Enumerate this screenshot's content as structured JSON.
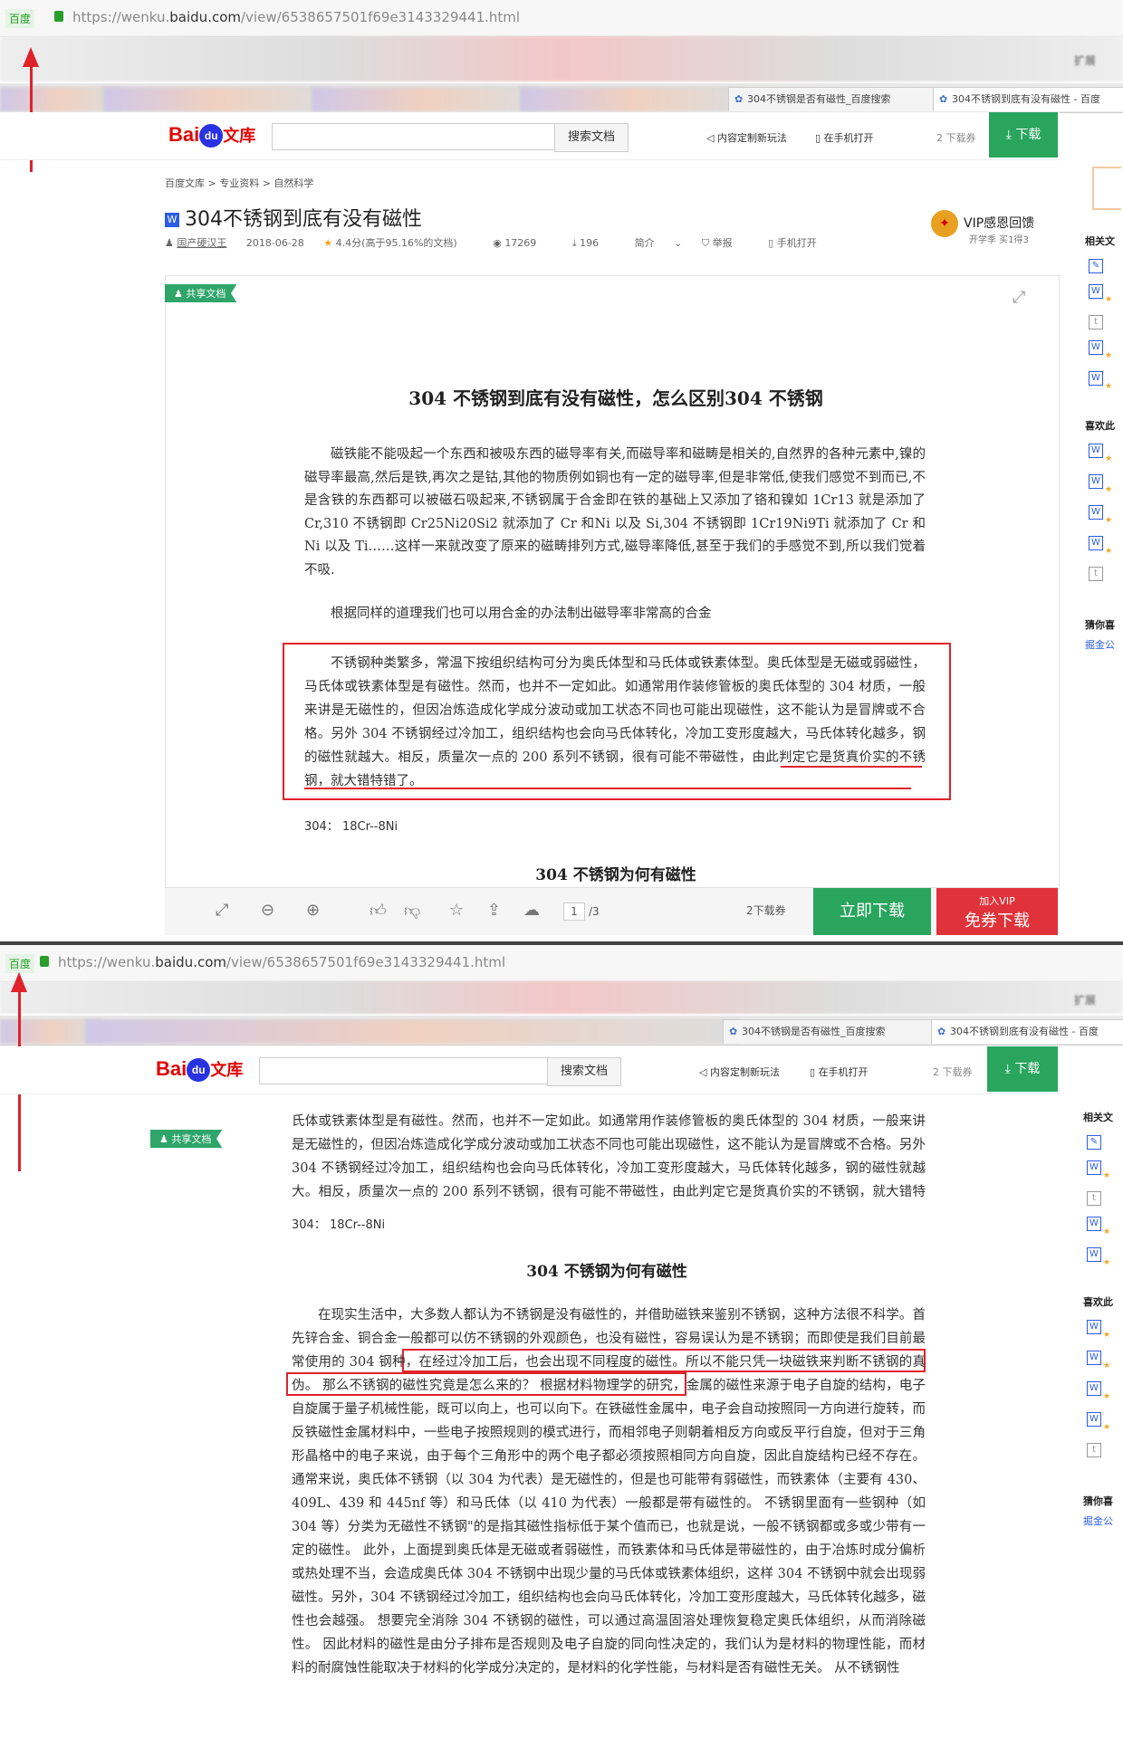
{
  "browser": {
    "site_tag": "百度",
    "url_prefix": "https://wenku.",
    "url_domain": "baidu.com",
    "url_path": "/view/6538657501f69e3143329441.html",
    "ext_label": "扩展",
    "tab_search_title": "304不锈钢是否有磁性_百度搜索",
    "tab_doc_title": "304不锈钢到底有没有磁性 - 百度"
  },
  "header": {
    "logo_bai": "Bai",
    "logo_du": "du",
    "logo_wenku": "文库",
    "search_button": "搜索文档",
    "link_custom": "内容定制新玩法",
    "link_phone": "在手机打开",
    "coupons": "2 下载券",
    "download": "下载"
  },
  "doc": {
    "breadcrumb": "百度文库 > 专业资料 > 自然科学",
    "title": "304不锈钢到底有没有磁性",
    "author": "国产硬汉王",
    "date": "2018-06-28",
    "rating": "4.4分(高于95.16%的文档)",
    "views": "17269",
    "downloads": "196",
    "intro": "简介",
    "report": "举报",
    "phone": "手机打开",
    "vip_title": "VIP感恩回馈",
    "vip_sub": "开学季 买1得3",
    "share_label": "共享文档",
    "heading1": "304 不锈钢到底有没有磁性，怎么区别304 不锈钢",
    "para1": "磁铁能不能吸起一个东西和被吸东西的磁导率有关,而磁导率和磁畴是相关的,自然界的各种元素中,镍的磁导率最高,然后是铁,再次之是钴,其他的物质例如铜也有一定的磁导率,但是非常低,使我们感觉不到而已,不是含铁的东西都可以被磁石吸起来,不锈钢属于合金即在铁的基础上又添加了铬和镍如 1Cr13 就是添加了 Cr,310 不锈钢即 Cr25Ni20Si2 就添加了 Cr 和Ni 以及 Si,304 不锈钢即 1Cr19Ni9Ti 就添加了 Cr 和 Ni 以及 Ti……这样一来就改变了原来的磁畴排列方式,磁导率降低,甚至于我们的手感觉不到,所以我们觉着不吸.",
    "para2": "根据同样的道理我们也可以用合金的办法制出磁导率非常高的合金",
    "para3a": "不锈钢种类繁多，常温下按组织结构可分为奥氏体型和马氏体或铁素体型。奥氏体型是无磁或弱磁性，马氏体或铁素体型是有磁性。然而，也并不一定如此。如通常用作装修管板的奥氏体型的 304 材质，一般来讲是无磁性的，但因冶炼造成化学成分波动或加工状态不同也可能出现磁性，这不能认为是冒牌或不合格。另外 304 不锈钢经过冷加工，组织结构也会向马氏体转化，冷加工变形度越大，马氏体转化越多，钢的磁性就越大。",
    "para3b": "相反，质量次一点的 200 系列不锈钢，很有可能不带磁性，由此判定它是货真价实的不锈钢，就大错特错了。",
    "line304": "304：    18Cr--8Ni",
    "heading2": "304 不锈钢为何有磁性",
    "para4a": "在现实生活中，大多数人都认为不锈钢是没有磁性的，并借助磁铁来鉴别不锈钢，这种方法很不科学。首先锌合金、铜合金一般都可以仿不锈钢的外观颜色，也没有磁性，容易误认为是不锈钢；",
    "para4b": "而即使是我们目前最常使用的 304 钢种，在经过冷加工后，也会出现不同程度的磁性。所以不能只凭一块磁铁来判断不锈钢的真伪。",
    "para4c": "那么不锈钢的磁性究竟是怎么来的？ 根据材料物理学的研究，金属的磁性来源于电子自旋的结构，电子自旋属于量子机械性能，既可以向上，也可以向下。在铁磁性金属中，电子会自动按照同一方向进行旋转，而反铁磁性金属材料中，一些电子按照规则的模式进行，而相邻电子则朝着相反方向或反平行自旋，但对于三角形晶格中的电子来说，由于每个三角形中的两个电子都必须按照相同方向自旋，因此自旋结构已经不存在。 通常来说，奥氏体不锈钢（以 304 为代表）是无磁性的，但是也可能带有弱磁性，而铁素体（主要有 430、409L、439 和 445nf 等）和马氏体（以 410 为代表）一般都是带有磁性的。 不锈钢里面有一些钢种（如 304 等）分类为无磁性不锈钢\"的是指其磁性指标低于某个值而已，也就是说，一般不锈钢都或多或少带有一定的磁性。 此外，上面提到奥氏体是无磁或者弱磁性，而铁素体和马氏体是带磁性的，由于冶炼时成分偏析或热处理不当，会造成奥氏体 304 不锈钢中出现少量的马氏体或铁素体组织，这样 304 不锈钢中就会出现弱磁性。另外，304 不锈钢经过冷加工，组织结构也会向马氏体转化，冷加工变形度越大，马氏体转化越多，磁性也会越强。 想要完全消除 304 不锈钢的磁性，可以通过高温固溶处理恢复稳定奥氏体组织，从而消除磁性。 因此材料的磁性是由分子排布是否规则及电子自旋的同向性决定的，我们认为是材料的物理性能，而材料的耐腐蚀性能取决于材料的化学成分决定的，是材料的化学性能，与材料是否有磁性无关。 从不锈钢性"
  },
  "toolbar": {
    "page_current": "1",
    "page_total": "/3",
    "coupons": "2下载券",
    "download_now": "立即下载",
    "join_vip": "加入VIP",
    "free_download": "免券下载"
  },
  "sidebar": {
    "related": "相关文",
    "liked": "喜欢此",
    "guess": "猜你喜",
    "link": "掘金公"
  },
  "colors": {
    "accent_green": "#29a55e",
    "highlight_red": "#e0222b",
    "vip_red": "#e0323a"
  }
}
